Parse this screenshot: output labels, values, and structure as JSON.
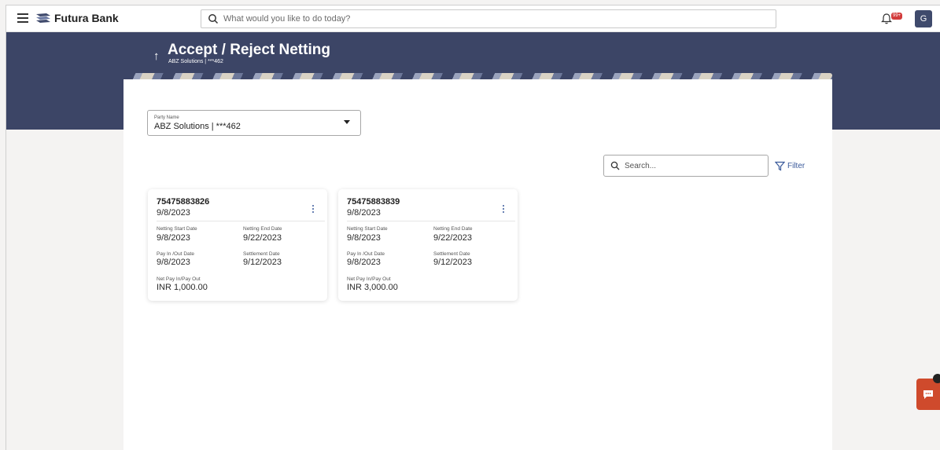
{
  "topbar": {
    "brand": "Futura Bank",
    "search_placeholder": "What would you like to do today?",
    "notification_badge": "99+",
    "avatar_initial": "G"
  },
  "header": {
    "title": "Accept / Reject Netting",
    "subtitle": "ABZ Solutions | ***462"
  },
  "party": {
    "label": "Party Name",
    "value": "ABZ Solutions | ***462"
  },
  "search": {
    "placeholder": "Search..."
  },
  "filter": {
    "label": "Filter"
  },
  "cards": [
    {
      "id": "75475883826",
      "date": "9/8/2023",
      "netting_start_label": "Netting Start Date",
      "netting_start": "9/8/2023",
      "netting_end_label": "Netting End Date",
      "netting_end": "9/22/2023",
      "pay_date_label": "Pay In /Out Date",
      "pay_date": "9/8/2023",
      "settlement_label": "Settlement Date",
      "settlement": "9/12/2023",
      "net_label": "Net Pay In/Pay Out",
      "net": "INR 1,000.00"
    },
    {
      "id": "75475883839",
      "date": "9/8/2023",
      "netting_start_label": "Netting Start Date",
      "netting_start": "9/8/2023",
      "netting_end_label": "Netting End Date",
      "netting_end": "9/22/2023",
      "pay_date_label": "Pay In /Out Date",
      "pay_date": "9/8/2023",
      "settlement_label": "Settlement Date",
      "settlement": "9/12/2023",
      "net_label": "Net Pay In/Pay Out",
      "net": "INR 3,000.00"
    }
  ],
  "colors": {
    "header_band": "#3c4566",
    "accent": "#3a5a9b",
    "badge": "#d23b3b",
    "chat": "#cf4a2c"
  }
}
